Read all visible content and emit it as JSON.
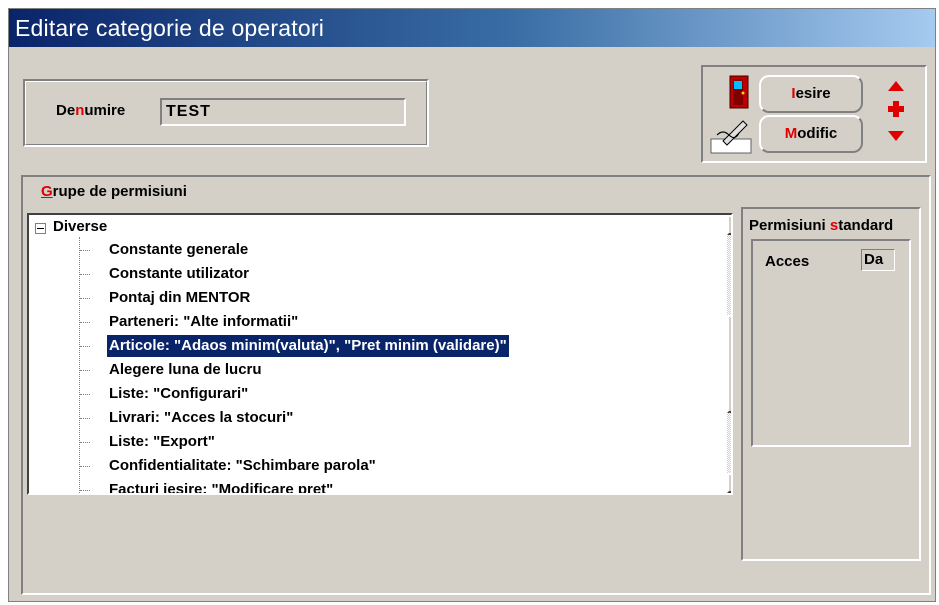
{
  "window": {
    "title": "Editare categorie de operatori"
  },
  "denumire": {
    "label_pre": "De",
    "label_hl": "n",
    "label_post": "umire",
    "value": "TEST"
  },
  "buttons": {
    "iesire": {
      "hl": "I",
      "rest": "esire"
    },
    "modific": {
      "hl": "M",
      "rest": "odific"
    }
  },
  "grupe": {
    "label_hl": "G",
    "label_rest": "rupe de permisiuni",
    "root": "Diverse",
    "items": [
      "Constante generale",
      "Constante utilizator",
      "Pontaj din MENTOR",
      "Parteneri: \"Alte informatii\"",
      "Articole: \"Adaos minim(valuta)\", \"Pret minim (validare)\"",
      "Alegere luna de lucru",
      "Liste: \"Configurari\"",
      "Livrari: \"Acces la stocuri\"",
      "Liste: \"Export\"",
      "Confidentialitate: \"Schimbare parola\"",
      "Facturi iesire: \"Modificare pret\""
    ],
    "selected_index": 4
  },
  "permisiuni": {
    "title_pre": "Permisiuni ",
    "title_hl": "s",
    "title_post": "tandard",
    "acces_label": "Acces",
    "acces_value": "Da"
  },
  "colors": {
    "title_start": "#0a246a",
    "title_end": "#a6caf0",
    "accent": "#e00000",
    "selection": "#0a246a"
  }
}
